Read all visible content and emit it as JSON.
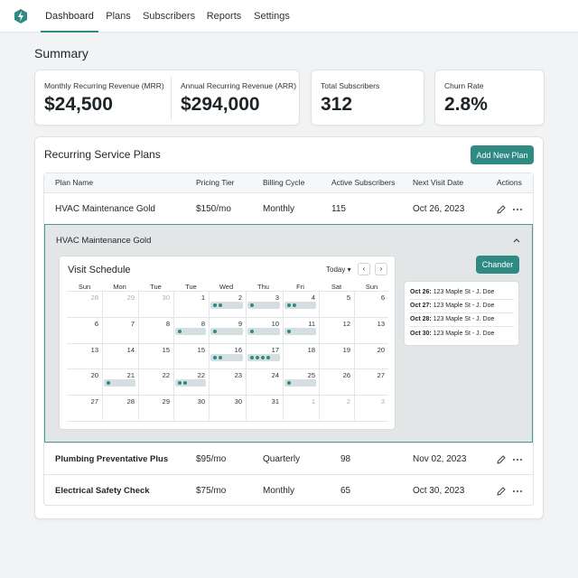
{
  "nav": {
    "tabs": [
      {
        "label": "Dashboard",
        "active": true
      },
      {
        "label": "Plans",
        "active": false
      },
      {
        "label": "Subscribers",
        "active": false
      },
      {
        "label": "Reports",
        "active": false
      },
      {
        "label": "Settings",
        "active": false
      }
    ],
    "logo_icon": "bolt-logo-icon"
  },
  "summary": {
    "title": "Summary",
    "metrics": [
      {
        "label": "Monthly Recurring Revenue (MRR)",
        "value": "$24,500"
      },
      {
        "label": "Annual Recurring Revenue (ARR)",
        "value": "$294,000"
      },
      {
        "label": "Total Subscribers",
        "value": "312"
      },
      {
        "label": "Churn Rate",
        "value": "2.8%"
      }
    ]
  },
  "plans": {
    "title": "Recurring Service Plans",
    "add_button": "Add New Plan",
    "columns": [
      "Plan Name",
      "Pricing Tier",
      "Billing Cycle",
      "Active Subscribers",
      "Next Visit Date",
      "Actions"
    ],
    "rows": [
      {
        "name": "HVAC Maintenance Gold",
        "price": "$150/mo",
        "cycle": "Monthly",
        "subscribers": "115",
        "next_visit": "Oct 26, 2023"
      },
      {
        "name": "Plumbing Preventative Plus",
        "price": "$95/mo",
        "cycle": "Quarterly",
        "subscribers": "98",
        "next_visit": "Nov 02, 2023"
      },
      {
        "name": "Electrical Safety Check",
        "price": "$75/mo",
        "cycle": "Monthly",
        "subscribers": "65",
        "next_visit": "Oct 30, 2023"
      }
    ]
  },
  "expanded": {
    "title": "HVAC Maintenance Gold",
    "change_button": "Chander",
    "calendar": {
      "title": "Visit Schedule",
      "today_label": "Today",
      "weekdays": [
        "Sun",
        "Mon",
        "Tue",
        "Tue",
        "Wed",
        "Thu",
        "Fri",
        "Sat",
        "Sun"
      ],
      "weeks": [
        [
          "28",
          "29",
          "30",
          "1",
          "2",
          "3",
          "4",
          "5",
          "6"
        ],
        [
          "6",
          "7",
          "8",
          "8",
          "9",
          "10",
          "11",
          "12",
          "13"
        ],
        [
          "13",
          "14",
          "15",
          "15",
          "16",
          "17",
          "18",
          "19",
          "20"
        ],
        [
          "20",
          "21",
          "22",
          "22",
          "23",
          "24",
          "25",
          "26",
          "27"
        ],
        [
          "27",
          "28",
          "29",
          "30",
          "30",
          "31",
          "1",
          "2",
          "3"
        ]
      ],
      "visit_counts": [
        [
          0,
          0,
          0,
          0,
          2,
          1,
          2,
          0,
          0
        ],
        [
          0,
          0,
          0,
          1,
          1,
          1,
          1,
          0,
          0
        ],
        [
          0,
          0,
          0,
          0,
          2,
          4,
          0,
          0,
          0
        ],
        [
          0,
          1,
          0,
          2,
          0,
          0,
          1,
          0,
          0
        ],
        [
          0,
          0,
          0,
          0,
          0,
          0,
          0,
          0,
          0
        ]
      ]
    },
    "upcoming": [
      {
        "date": "Oct 26:",
        "detail": "123 Maple St - J. Doe"
      },
      {
        "date": "Oct 27:",
        "detail": "123 Maple St - J. Doe"
      },
      {
        "date": "Oct 28:",
        "detail": "123 Maple St - J. Doe"
      },
      {
        "date": "Oct 30:",
        "detail": "123 Maple St - J. Doe"
      }
    ]
  },
  "colors": {
    "accent": "#2e8a82",
    "expanded_bg": "#e2e6e6"
  }
}
